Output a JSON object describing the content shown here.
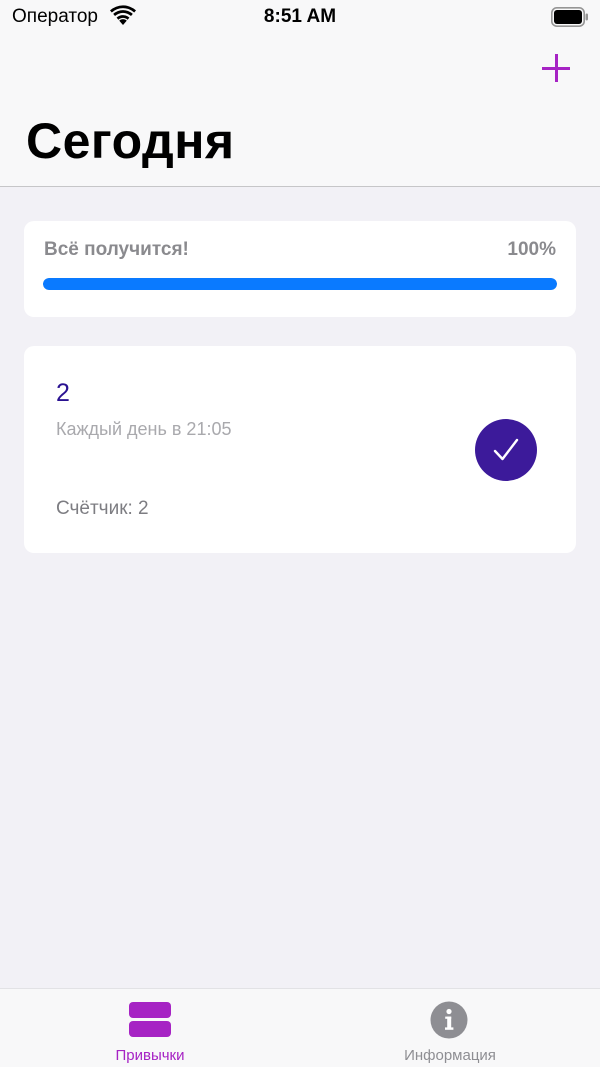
{
  "status_bar": {
    "carrier": "Оператор",
    "time": "8:51 AM",
    "wifi_icon": "wifi-icon",
    "battery_icon": "battery-full-icon"
  },
  "nav": {
    "title": "Сегодня",
    "add_icon": "plus-icon",
    "accent_color": "#a623c4"
  },
  "progress": {
    "label": "Всё получится!",
    "percent_text": "100%",
    "value": 1.0,
    "bar_color": "#0a7aff"
  },
  "habits": [
    {
      "name": "2",
      "schedule": "Каждый день в 21:05",
      "counter": "Счётчик: 2",
      "done": true,
      "color": "#3c1a9a",
      "check_icon": "checkmark-icon"
    }
  ],
  "tab_bar": {
    "items": [
      {
        "label": "Привычки",
        "icon": "rectangle-stack-icon",
        "active": true
      },
      {
        "label": "Информация",
        "icon": "info-circle-icon",
        "active": false
      }
    ]
  }
}
